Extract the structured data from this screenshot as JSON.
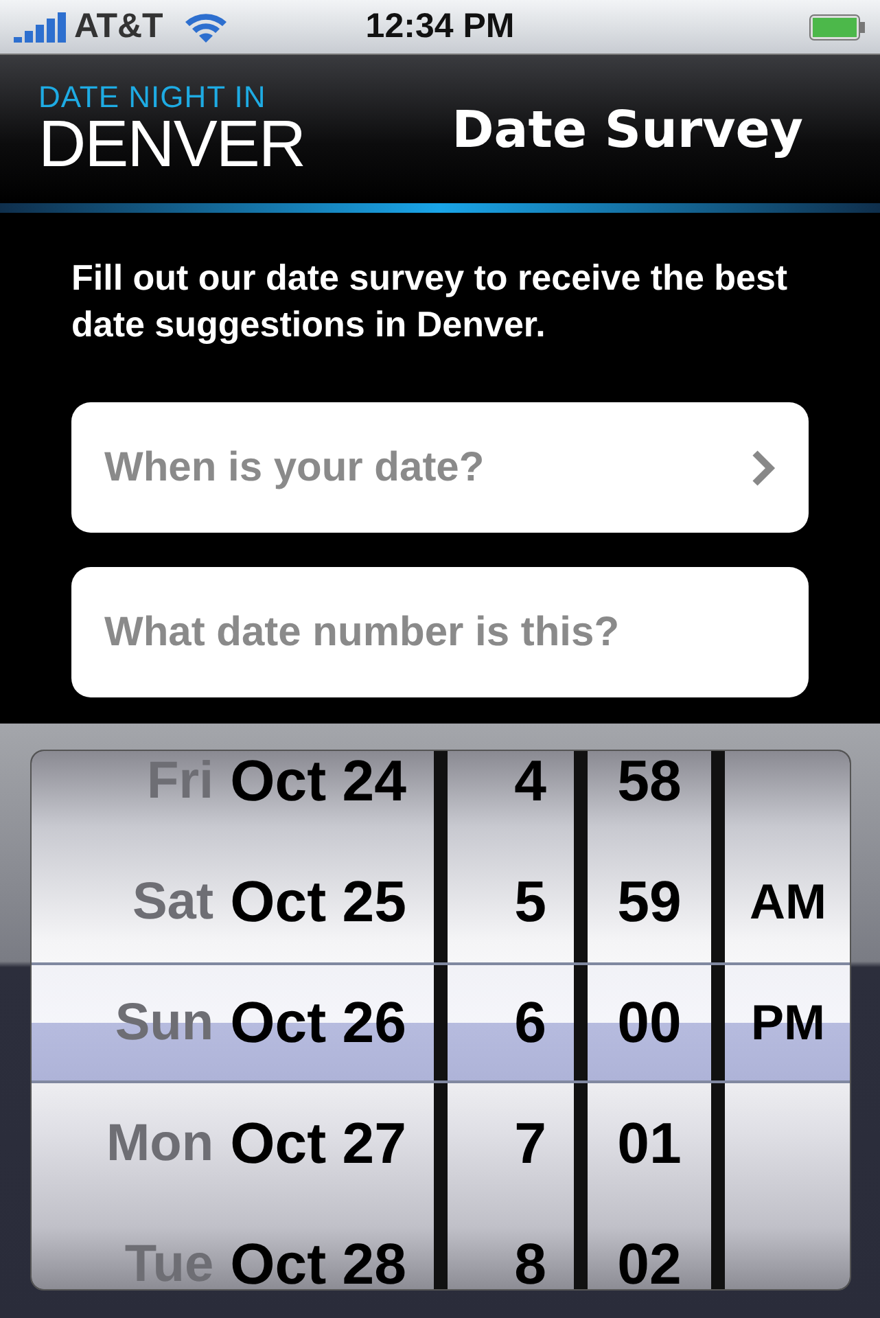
{
  "status_bar": {
    "carrier": "AT&T",
    "time": "12:34 PM"
  },
  "header": {
    "logo_top": "DATE NIGHT IN",
    "logo_bottom": "DENVER",
    "title": "Date Survey"
  },
  "intro": "Fill out our date survey to receive the best date suggestions in Denver.",
  "fields": [
    {
      "kind": "select",
      "placeholder": "When is your date?"
    },
    {
      "kind": "text",
      "placeholder": "What date number is this?"
    }
  ],
  "picker": {
    "rows": [
      {
        "weekday": "Fri",
        "date": "Oct 24",
        "hour": "4",
        "minute": "58",
        "selected": false
      },
      {
        "weekday": "Sat",
        "date": "Oct 25",
        "hour": "5",
        "minute": "59",
        "period": "AM",
        "selected": false
      },
      {
        "weekday": "Sun",
        "date": "Oct 26",
        "hour": "6",
        "minute": "00",
        "period": "PM",
        "selected": true
      },
      {
        "weekday": "Mon",
        "date": "Oct 27",
        "hour": "7",
        "minute": "01",
        "selected": false
      },
      {
        "weekday": "Tue",
        "date": "Oct 28",
        "hour": "8",
        "minute": "02",
        "selected": false
      }
    ]
  }
}
